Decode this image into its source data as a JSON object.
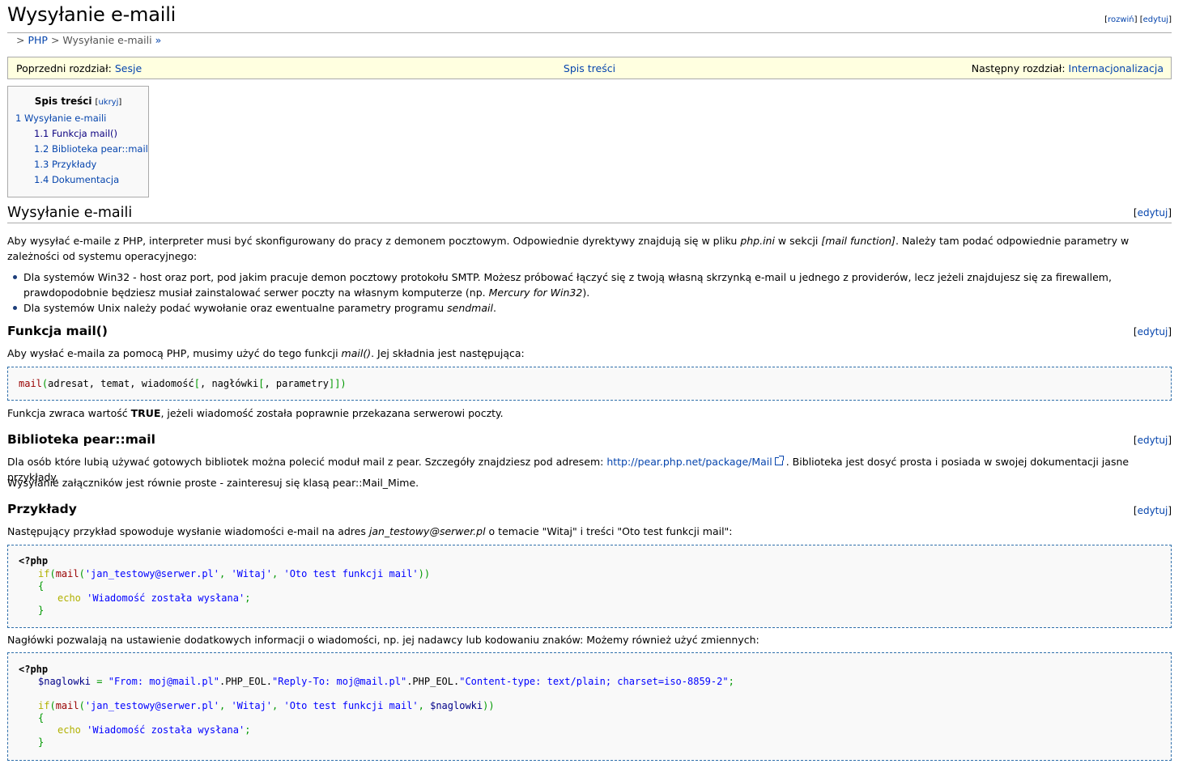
{
  "page": {
    "title": "Wysyłanie e-maili",
    "top_links": {
      "expand": "rozwiń",
      "edit": "edytuj"
    }
  },
  "breadcrumb": {
    "lead": ">",
    "php": "PHP",
    "sep": ">",
    "current": "Wysyłanie e-maili",
    "more": "»"
  },
  "navbox": {
    "prev_label": "Poprzedni rozdział:",
    "prev_link": "Sesje",
    "toc_link": "Spis treści",
    "next_label": "Następny rozdział:",
    "next_link": "Internacjonalizacja"
  },
  "toc": {
    "title": "Spis treści",
    "hide": "ukryj",
    "items": [
      "1 Wysyłanie e-maili",
      "1.1 Funkcja mail()",
      "1.2 Biblioteka pear::mail",
      "1.3 Przykłady",
      "1.4 Dokumentacja"
    ]
  },
  "edit_label": "edytuj",
  "section1": {
    "heading": "Wysyłanie e-maili",
    "intro_a": "Aby wysyłać e-maile z PHP, interpreter musi być skonfigurowany do pracy z demonem pocztowym. Odpowiednie dyrektywy znajdują się w pliku ",
    "intro_file": "php.ini",
    "intro_b": " w sekcji ",
    "intro_section": "[mail function]",
    "intro_c": ". Należy tam podać odpowiednie parametry w zależności od systemu operacyjnego:",
    "bullet1_a": "Dla systemów Win32 - host oraz port, pod jakim pracuje demon pocztowy protokołu SMTP. Możesz próbować łączyć się z twoją własną skrzynką e-mail u jednego z providerów, lecz jeżeli znajdujesz się za firewallem, prawdopodobnie będziesz musiał zainstalować serwer poczty na własnym komputerze (np. ",
    "bullet1_italic": "Mercury for Win32",
    "bullet1_b": ").",
    "bullet2_a": "Dla systemów Unix należy podać wywołanie oraz ewentualne parametry programu ",
    "bullet2_italic": "sendmail",
    "bullet2_b": "."
  },
  "section2": {
    "heading": "Funkcja mail()",
    "text_a": "Aby wysłać e-maila za pomocą PHP, musimy użyć do tego funkcji ",
    "text_fn": "mail()",
    "text_b": ". Jej składnia jest następująca:",
    "code": {
      "fn": "mail",
      "open": "(",
      "args": "adresat, temat, wiadomość",
      "opt1": "[",
      "arg2": ", nagłówki",
      "opt2": "[",
      "arg3": ", parametry",
      "close": "]])"
    },
    "after_a": "Funkcja zwraca wartość ",
    "after_bold": "TRUE",
    "after_b": ", jeżeli wiadomość została poprawnie przekazana serwerowi poczty."
  },
  "section3": {
    "heading": "Biblioteka pear::mail",
    "text_a": "Dla osób które lubią używać gotowych bibliotek można polecić moduł mail z pear. Szczegóły znajdziesz pod adresem: ",
    "link": "http://pear.php.net/package/Mail",
    "text_b": " . Biblioteka jest dosyć prosta i posiada w swojej dokumentacji jasne przykłady.",
    "text2": "Wysyłanie załączników jest równie proste - zainteresuj się klasą pear::Mail_Mime."
  },
  "section4": {
    "heading": "Przykłady",
    "text_a": "Następujący przykład spowoduje wysłanie wiadomości e-mail na adres ",
    "text_email": "jan_testowy@serwer.pl",
    "text_b": " o temacie \"Witaj\" i treści \"Oto test funkcji mail\":",
    "code1": {
      "open_tag": "<?php",
      "if": "if",
      "paren": "(",
      "mail": "mail",
      "p2": "(",
      "s1": "'jan_testowy@serwer.pl'",
      "comma1": ", ",
      "s2": "'Witaj'",
      "comma2": ", ",
      "s3": "'Oto test funkcji mail'",
      "close": "))",
      "brace_open": "{",
      "echo": "echo",
      "s4": "'Wiadomość została wysłana'",
      "semi": ";",
      "brace_close": "}"
    },
    "text2": "Nagłówki pozwalają na ustawienie dodatkowych informacji o wiadomości, np. jej nadawcy lub kodowaniu znaków: Możemy również użyć zmiennych:",
    "code2": {
      "open_tag": "<?php",
      "var": "$naglowki",
      "eq": " = ",
      "s1": "\"From: moj@mail.pl\"",
      "cat1": ".PHP_EOL.",
      "s2": "\"Reply-To: moj@mail.pl\"",
      "cat2": ".PHP_EOL.",
      "s3": "\"Content-type: text/plain; charset=iso-8859-2\"",
      "semi": ";",
      "if": "if",
      "paren": "(",
      "mail": "mail",
      "p2": "(",
      "a1": "'jan_testowy@serwer.pl'",
      "comma": ", ",
      "a2": "'Witaj'",
      "a3": "'Oto test funkcji mail'",
      "var2": "$naglowki",
      "close": "))",
      "brace_open": "{",
      "echo": "echo",
      "s4": "'Wiadomość została wysłana'",
      "brace_close": "}"
    }
  }
}
